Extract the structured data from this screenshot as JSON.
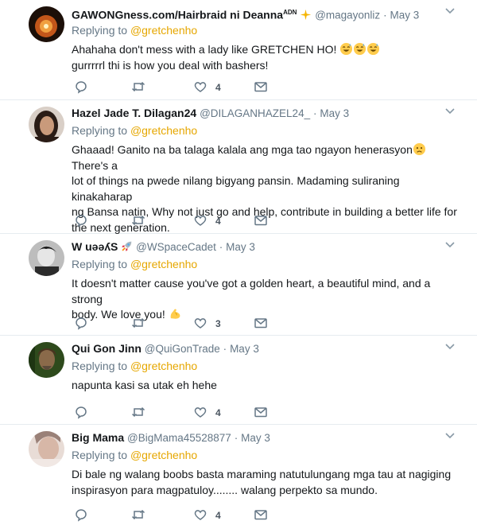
{
  "tweets": [
    {
      "name": "GAWONGness.com/Hairbraid ni Deanna",
      "name_sup": "ADN",
      "handle": "@magayonliz",
      "date": "May 3",
      "replying_prefix": "Replying to",
      "mention": "@gretchenho",
      "text_lines": [
        "Ahahaha don't mess with a lady like GRETCHEN HO!",
        "gurrrrrl thi is how you deal with bashers!"
      ],
      "like_count": "4"
    },
    {
      "name": "Hazel Jade T. Dilagan24",
      "handle": "@DILAGANHAZEL24_",
      "date": "May 3",
      "replying_prefix": "Replying to",
      "mention": "@gretchenho",
      "text_lines": [
        "Ghaaad! Ganito na ba talaga kalala ang mga tao ngayon henerasyon",
        " There's a",
        "lot of things na pwede nilang bigyang pansin. Madaming suliraning kinakaharap",
        "ng Bansa natin, Why not just go and help, contribute in building a better life for",
        "the next generation."
      ],
      "like_count": "4"
    },
    {
      "name": "W uəəʎS",
      "handle": "@WSpaceCadet",
      "date": "May 3",
      "replying_prefix": "Replying to",
      "mention": "@gretchenho",
      "text_lines": [
        "It doesn't matter cause you've got a golden heart, a beautiful mind, and a strong",
        "body. We love you!"
      ],
      "like_count": "3"
    },
    {
      "name": "Qui Gon Jinn",
      "handle": "@QuiGonTrade",
      "date": "May 3",
      "replying_prefix": "Replying to",
      "mention": "@gretchenho",
      "text_lines": [
        "napunta kasi sa utak eh hehe"
      ],
      "like_count": "4"
    },
    {
      "name": "Big Mama",
      "handle": "@BigMama45528877",
      "date": "May 3",
      "replying_prefix": "Replying to",
      "mention": "@gretchenho",
      "text_lines": [
        "Di bale ng walang boobs basta maraming natutulungang mga tau at nagiging",
        "inspirasyon para magpatuloy........ walang perpekto sa mundo."
      ],
      "like_count": "4"
    }
  ],
  "separator_dot": "·",
  "colors": {
    "mention": "#e6a700",
    "muted": "#657786",
    "border": "#e6ecf0"
  }
}
